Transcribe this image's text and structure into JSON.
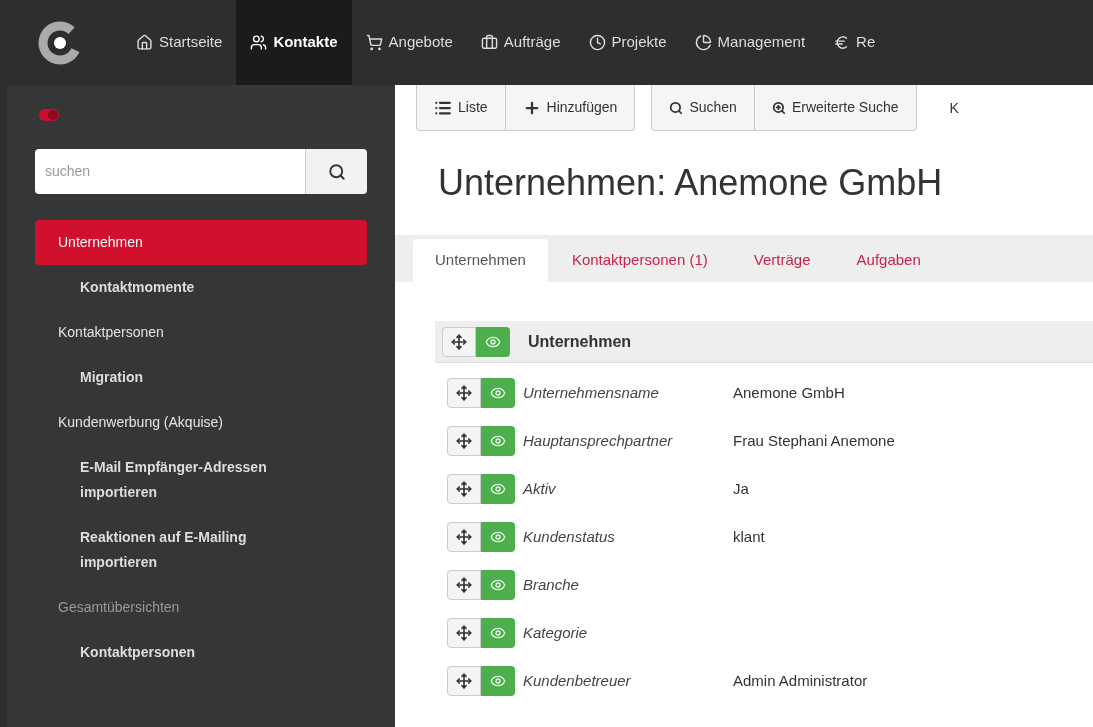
{
  "top_nav": {
    "items": [
      {
        "label": "Startseite",
        "selected": false
      },
      {
        "label": "Kontakte",
        "selected": true
      },
      {
        "label": "Angebote",
        "selected": false
      },
      {
        "label": "Aufträge",
        "selected": false
      },
      {
        "label": "Projekte",
        "selected": false
      },
      {
        "label": "Management",
        "selected": false
      },
      {
        "label": "Re",
        "selected": false
      }
    ]
  },
  "sidebar": {
    "toggle": {
      "on": true
    },
    "search": {
      "placeholder": "suchen"
    },
    "items": [
      {
        "label": "Unternehmen",
        "kind": "item",
        "selected": true
      },
      {
        "label": "Kontaktmomente",
        "kind": "subitem",
        "selected": false
      },
      {
        "label": "Kontaktpersonen",
        "kind": "item",
        "selected": false
      },
      {
        "label": "Migration",
        "kind": "subitem",
        "selected": false
      },
      {
        "label": "Kundenwerbung (Akquise)",
        "kind": "item",
        "selected": false
      },
      {
        "label": "E-Mail Empfänger-Adressen importieren",
        "kind": "subitem",
        "selected": false
      },
      {
        "label": "Reaktionen auf E-Mailing importieren",
        "kind": "subitem",
        "selected": false
      },
      {
        "label": "Gesamtübersichten",
        "kind": "heading",
        "selected": false
      },
      {
        "label": "Kontaktpersonen",
        "kind": "subitem",
        "selected": false
      }
    ]
  },
  "toolbar": {
    "groups": [
      [
        {
          "label": "Liste"
        },
        {
          "label": "Hinzufügen"
        }
      ],
      [
        {
          "label": "Suchen"
        },
        {
          "label": "Erweiterte Suche"
        }
      ],
      [
        {
          "label": "K"
        }
      ]
    ]
  },
  "title": "Unternehmen: Anemone GmbH",
  "tabs": [
    {
      "label": "Unternehmen",
      "selected": true
    },
    {
      "label": "Kontaktpersonen (1)",
      "selected": false
    },
    {
      "label": "Verträge",
      "selected": false
    },
    {
      "label": "Aufgaben",
      "selected": false
    }
  ],
  "section": {
    "title": "Unternehmen",
    "visible": true
  },
  "fields": [
    {
      "label": "Unternehmensname",
      "value": "Anemone GmbH",
      "visible": true
    },
    {
      "label": "Hauptansprechpartner",
      "value": "Frau Stephani Anemone",
      "visible": true
    },
    {
      "label": "Aktiv",
      "value": "Ja",
      "visible": true
    },
    {
      "label": "Kundenstatus",
      "value": "klant",
      "visible": true
    },
    {
      "label": "Branche",
      "visible": true
    },
    {
      "label": "Kategorie",
      "visible": true
    },
    {
      "label": "Kundenbetreuer",
      "value": "Admin Administrator",
      "visible": true
    }
  ]
}
